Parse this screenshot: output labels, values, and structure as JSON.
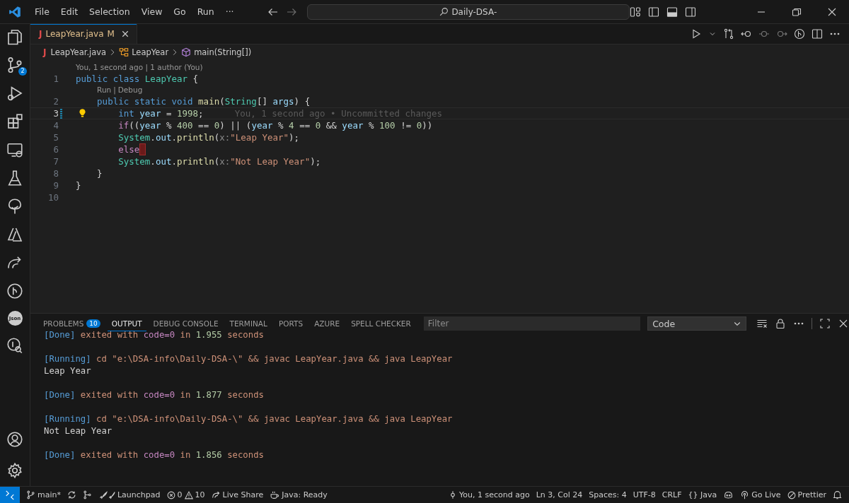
{
  "title_bar": {
    "menu": [
      "File",
      "Edit",
      "Selection",
      "View",
      "Go",
      "Run",
      "···"
    ],
    "search": "Daily-DSA-"
  },
  "activity_bar": {
    "source_control_badge": "2",
    "json_icon_text": "Json"
  },
  "editor_tabs": [
    {
      "icon_text": "J",
      "label": "LeapYear.java",
      "status": "M",
      "selected": true
    }
  ],
  "breadcrumbs": {
    "file_icon_text": "J",
    "items": [
      "LeapYear.java",
      "LeapYear",
      "main(String[])"
    ]
  },
  "code_lines": [
    {
      "number": "1",
      "codelens": [
        "You, 1 second ago | 1 author (You)"
      ],
      "tokens": [
        {
          "t": "public class ",
          "color": "#569cd6"
        },
        {
          "t": "LeapYear",
          "color": "#4ec9b0"
        },
        {
          "t": " {"
        }
      ],
      "children": [
        {
          "number": "2",
          "codelens": [
            "Run",
            "|",
            "Debug"
          ],
          "tokens": [
            {
              "t": "public static void ",
              "color": "#569cd6"
            },
            {
              "t": "main",
              "color": "#dcdcaa"
            },
            {
              "t": "("
            },
            {
              "t": "String",
              "color": "#4ec9b0"
            },
            {
              "t": "[] "
            },
            {
              "t": "args",
              "color": "#9cdcfe"
            },
            {
              "t": ") {"
            }
          ],
          "children": [
            {
              "number": "3",
              "current": true,
              "modified": true,
              "lightbulb": true,
              "blame": "You, 1 second ago • Uncommitted changes",
              "tokens": [
                {
                  "t": "int ",
                  "color": "#569cd6"
                },
                {
                  "t": "year",
                  "color": "#9cdcfe"
                },
                {
                  "t": " = "
                },
                {
                  "t": "1998",
                  "color": "#b5cea8"
                },
                {
                  "t": ";"
                }
              ]
            },
            {
              "number": "4",
              "tokens": [
                {
                  "t": "if",
                  "color": "#c586c0"
                },
                {
                  "t": "(("
                },
                {
                  "t": "year",
                  "color": "#9cdcfe"
                },
                {
                  "t": " % "
                },
                {
                  "t": "400",
                  "color": "#b5cea8"
                },
                {
                  "t": " == "
                },
                {
                  "t": "0",
                  "color": "#b5cea8"
                },
                {
                  "t": ") || ("
                },
                {
                  "t": "year",
                  "color": "#9cdcfe"
                },
                {
                  "t": " % "
                },
                {
                  "t": "4",
                  "color": "#b5cea8"
                },
                {
                  "t": " == "
                },
                {
                  "t": "0",
                  "color": "#b5cea8"
                },
                {
                  "t": " && "
                },
                {
                  "t": "year",
                  "color": "#9cdcfe"
                },
                {
                  "t": " % "
                },
                {
                  "t": "100",
                  "color": "#b5cea8"
                },
                {
                  "t": " != "
                },
                {
                  "t": "0",
                  "color": "#b5cea8"
                },
                {
                  "t": "))"
                }
              ]
            },
            {
              "number": "5",
              "tokens": [
                {
                  "t": "System",
                  "color": "#4ec9b0"
                },
                {
                  "t": "."
                },
                {
                  "t": "out",
                  "color": "#9cdcfe"
                },
                {
                  "t": "."
                },
                {
                  "t": "println",
                  "color": "#dcdcaa"
                },
                {
                  "t": "("
                },
                {
                  "t": "x:",
                  "color": "#8a8a8a"
                },
                {
                  "t": "\"Leap Year\"",
                  "color": "#ce9178"
                },
                {
                  "t": ");"
                }
              ]
            },
            {
              "number": "6",
              "error_marker": true,
              "tokens": [
                {
                  "t": "else",
                  "color": "#c586c0"
                }
              ]
            },
            {
              "number": "7",
              "tokens": [
                {
                  "t": "System",
                  "color": "#4ec9b0"
                },
                {
                  "t": "."
                },
                {
                  "t": "out",
                  "color": "#9cdcfe"
                },
                {
                  "t": "."
                },
                {
                  "t": "println",
                  "color": "#dcdcaa"
                },
                {
                  "t": "("
                },
                {
                  "t": "x:",
                  "color": "#8a8a8a"
                },
                {
                  "t": "\"Not Leap Year\"",
                  "color": "#ce9178"
                },
                {
                  "t": ");"
                }
              ]
            }
          ]
        },
        {
          "number": "8",
          "tokens": [
            {
              "t": "}"
            }
          ]
        }
      ]
    },
    {
      "number": "9",
      "tokens": [
        {
          "t": "}"
        }
      ]
    },
    {
      "number": "10"
    }
  ],
  "panel": {
    "tabs": [
      {
        "label": "PROBLEMS",
        "badge": "10",
        "selected": false
      },
      {
        "label": "OUTPUT",
        "selected": true
      },
      {
        "label": "DEBUG CONSOLE",
        "selected": false
      },
      {
        "label": "TERMINAL",
        "selected": false
      },
      {
        "label": "PORTS",
        "selected": false
      },
      {
        "label": "AZURE",
        "selected": false
      },
      {
        "label": "SPELL CHECKER",
        "selected": false
      }
    ],
    "filter": {
      "placeholder": "Filter"
    },
    "channel": "Code",
    "output_blocks": [
      [
        [
          {
            "t": "[Done]",
            "color": "#569cd6"
          },
          {
            "t": " exited with ",
            "color": "#ce9178"
          },
          {
            "t": "code=0",
            "color": "#c586c0"
          },
          {
            "t": " in ",
            "color": "#ce9178"
          },
          {
            "t": "1.955",
            "color": "#b5cea8"
          },
          {
            "t": " seconds",
            "color": "#ce9178"
          }
        ]
      ],
      [
        [
          {
            "t": "[Running]",
            "color": "#569cd6"
          },
          {
            "t": " cd \"e:\\DSA-info\\Daily-DSA-\\\" && javac LeapYear.java && java LeapYear",
            "color": "#ce9178"
          }
        ],
        [
          {
            "t": "Leap Year"
          }
        ]
      ],
      [
        [
          {
            "t": "[Done]",
            "color": "#569cd6"
          },
          {
            "t": " exited with ",
            "color": "#ce9178"
          },
          {
            "t": "code=0",
            "color": "#c586c0"
          },
          {
            "t": " in ",
            "color": "#ce9178"
          },
          {
            "t": "1.877",
            "color": "#b5cea8"
          },
          {
            "t": " seconds",
            "color": "#ce9178"
          }
        ]
      ],
      [
        [
          {
            "t": "[Running]",
            "color": "#569cd6"
          },
          {
            "t": " cd \"e:\\DSA-info\\Daily-DSA-\\\" && javac LeapYear.java && java LeapYear",
            "color": "#ce9178"
          }
        ],
        [
          {
            "t": "Not Leap Year"
          }
        ]
      ],
      [
        [
          {
            "t": "[Done]",
            "color": "#569cd6"
          },
          {
            "t": " exited with ",
            "color": "#ce9178"
          },
          {
            "t": "code=0",
            "color": "#c586c0"
          },
          {
            "t": " in ",
            "color": "#ce9178"
          },
          {
            "t": "1.856",
            "color": "#b5cea8"
          },
          {
            "t": " seconds",
            "color": "#ce9178"
          }
        ]
      ]
    ]
  },
  "status_bar": {
    "branch": "main*",
    "launchpad": "Launchpad",
    "errors": "0",
    "warnings": "10",
    "live_share": "Live Share",
    "java_status": "Java: Ready",
    "blame": "You, 1 second ago",
    "position": "Ln 3, Col 24",
    "indentation": "Spaces: 4",
    "encoding": "UTF-8",
    "eol": "CRLF",
    "language_icon_text": "{}",
    "language": "Java",
    "go_live": "Go Live",
    "formatter": "Prettier"
  }
}
